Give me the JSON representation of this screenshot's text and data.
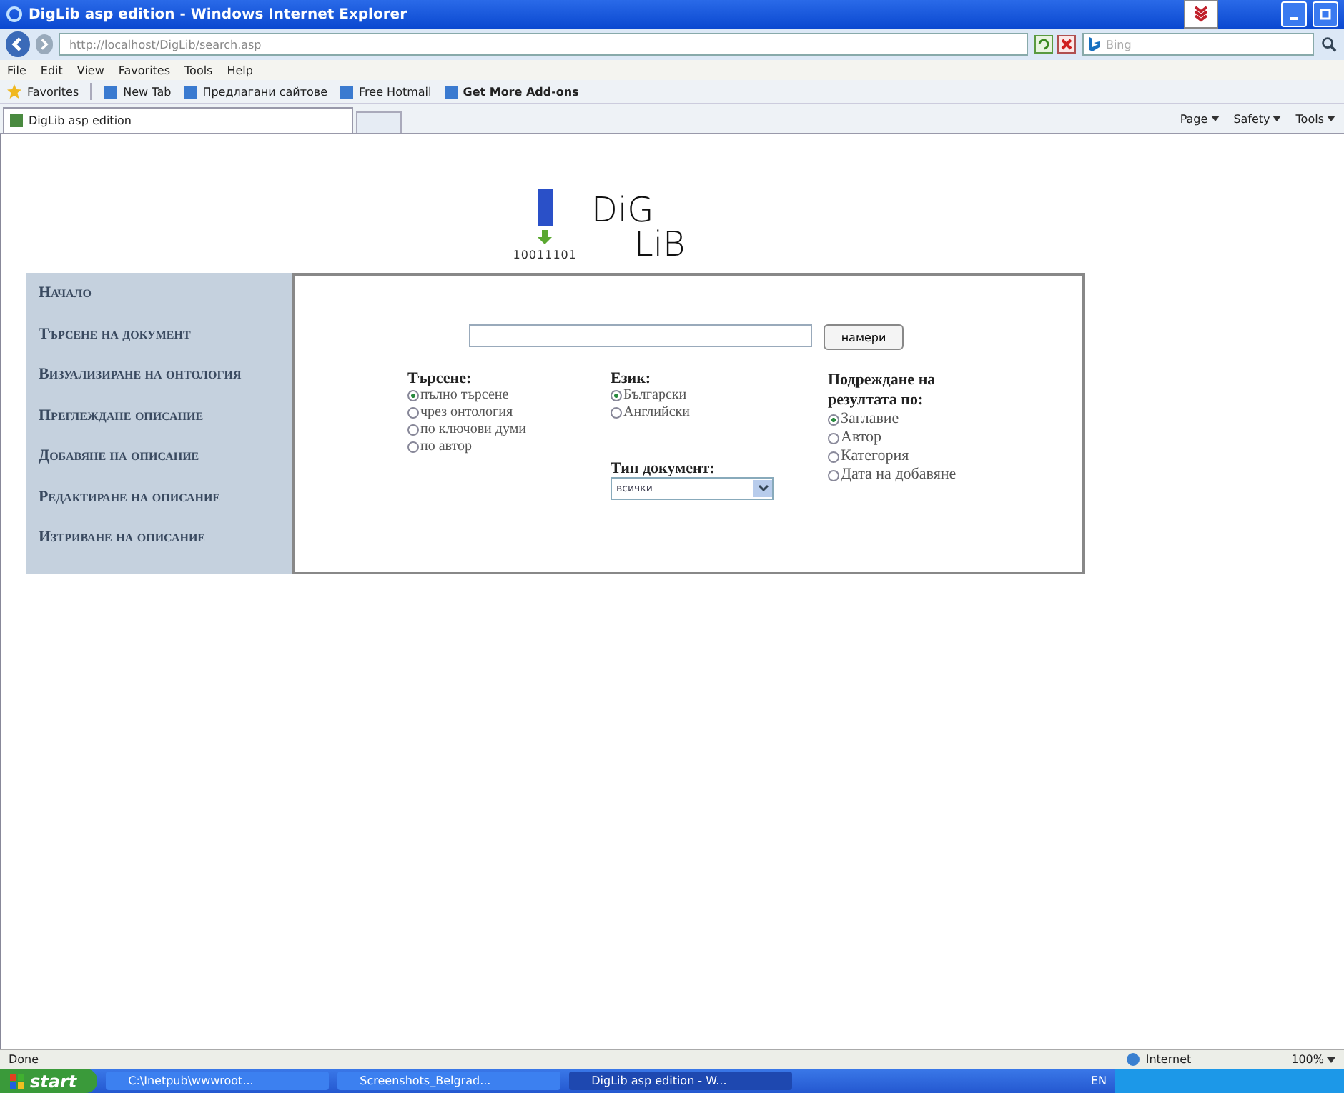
{
  "window": {
    "title": "DigLib asp edition - Windows Internet Explorer"
  },
  "address_bar": {
    "url": "http://localhost/DigLib/search.asp",
    "search_placeholder": "Bing"
  },
  "menu": [
    "File",
    "Edit",
    "View",
    "Favorites",
    "Tools",
    "Help"
  ],
  "favorites_bar": {
    "label": "Favorites",
    "links": [
      "New Tab",
      "Предлагани сайтове",
      "Free Hotmail",
      "Get More Add-ons"
    ]
  },
  "tab": {
    "title": "DigLib asp edition"
  },
  "command_bar": [
    "Page",
    "Safety",
    "Tools"
  ],
  "logo": {
    "line_1": "DiG",
    "line_2": "LiB",
    "binary": "10011101"
  },
  "nav": [
    "Начало",
    "Търсене на документ",
    "Визуализиране на онтология",
    "Преглеждане описание",
    "Добавяне на описание",
    "Редактиране на описание",
    "Изтриване на описание"
  ],
  "search": {
    "button": "намери"
  },
  "search_type": {
    "label": "Търсене:",
    "options": [
      {
        "label": "пълно търсене",
        "selected": true
      },
      {
        "label": "чрез онтология",
        "selected": false
      },
      {
        "label": "по ключови думи",
        "selected": false
      },
      {
        "label": "по автор",
        "selected": false
      }
    ]
  },
  "language": {
    "label": "Език:",
    "options": [
      {
        "label": "Български",
        "selected": true
      },
      {
        "label": "Английски",
        "selected": false
      }
    ]
  },
  "document_type": {
    "label": "Тип документ:",
    "value": "всички"
  },
  "sort": {
    "label": "Подреждане на резултата по:",
    "options": [
      {
        "label": "Заглавие",
        "selected": true
      },
      {
        "label": "Автор",
        "selected": false
      },
      {
        "label": "Категория",
        "selected": false
      },
      {
        "label": "Дата на добавяне",
        "selected": false
      }
    ]
  },
  "status_bar": {
    "text": "Done",
    "zone": "Internet",
    "zoom": "100%"
  },
  "taskbar": {
    "start": "start",
    "items": [
      "C:\\Inetpub\\wwwroot...",
      "Screenshots_Belgrad...",
      "DigLib asp edition - W..."
    ],
    "language": "EN"
  }
}
